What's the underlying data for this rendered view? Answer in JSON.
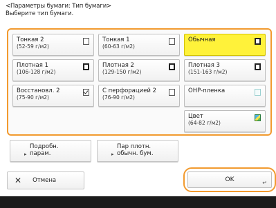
{
  "header": {
    "line1": "<Параметры бумаги: Тип бумаги>",
    "line2": "Выберите тип бумаги."
  },
  "paper_types": {
    "thin2": {
      "name": "Тонкая 2",
      "range": "(52-59 г/м2)",
      "icon": "paper-icon"
    },
    "thin1": {
      "name": "Тонкая 1",
      "range": "(60-63 г/м2)",
      "icon": "paper-icon"
    },
    "plain": {
      "name": "Обычная",
      "range": "",
      "icon": "paper-icon",
      "selected": true
    },
    "heavy1": {
      "name": "Плотная 1",
      "range": "(106-128 г/м2)",
      "icon": "heavy-paper-icon"
    },
    "heavy2": {
      "name": "Плотная 2",
      "range": "(129-150 г/м2)",
      "icon": "heavy-paper-icon"
    },
    "heavy3": {
      "name": "Плотная 3",
      "range": "(151-163 г/м2)",
      "icon": "heavy-paper-icon"
    },
    "recycled2": {
      "name": "Восстановл. 2",
      "range": "(75-90 г/м2)",
      "icon": "recycled-paper-icon"
    },
    "punched2": {
      "name": "С перфорацией 2",
      "range": "(76-90 г/м2)",
      "icon": "punched-paper-icon"
    },
    "ohp": {
      "name": "OHP-пленка",
      "range": "",
      "icon": "transparency-icon"
    },
    "color": {
      "name": "Цвет",
      "range": "(64-82 г/м2)",
      "icon": "color-paper-icon"
    }
  },
  "actions": {
    "details_line1": "Подробн.",
    "details_line2": "парам.",
    "pair_line1": "Пар плотн.",
    "pair_line2": "обычн. бум.",
    "cancel_label": "Отмена",
    "ok_label": "OK"
  },
  "colors": {
    "accent": "#f29a2e",
    "selected": "#fff23a"
  }
}
